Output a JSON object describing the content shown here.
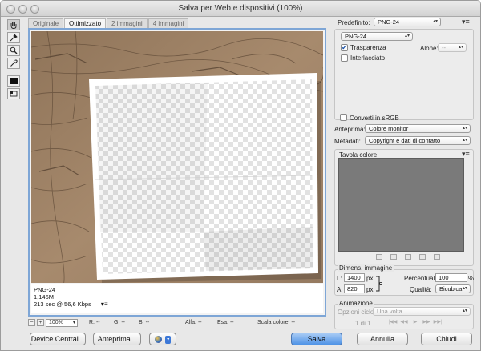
{
  "window": {
    "title": "Salva per Web e dispositivi (100%)"
  },
  "tabs": [
    "Originale",
    "Ottimizzato",
    "2 immagini",
    "4 immagini"
  ],
  "tools": [
    "hand-icon",
    "slice-select-icon",
    "zoom-icon",
    "eyedropper-icon",
    "color-swatch",
    "toggle-slices-icon"
  ],
  "preview_info": {
    "format": "PNG-24",
    "size": "1,146M",
    "time": "213 sec @ 56,6 Kbps",
    "menu": "▾≡"
  },
  "bottom_bar": {
    "zoom_minus": "−",
    "zoom_plus": "+",
    "zoom": "100%",
    "r_label": "R:",
    "r_value": "--",
    "g_label": "G:",
    "g_value": "--",
    "b_label": "B:",
    "b_value": "--",
    "alpha_label": "Alfa:",
    "alpha_value": "--",
    "esa_label": "Esa:",
    "esa_value": "--",
    "scale_label": "Scala colore:",
    "scale_value": "--"
  },
  "footer": {
    "device_central": "Device Central...",
    "preview": "Anteprima...",
    "save": "Salva",
    "cancel": "Annulla",
    "done": "Chiudi"
  },
  "settings": {
    "preset_label": "Predefinito:",
    "preset_value": "PNG-24",
    "panel_menu": "▾≡",
    "format_value": "PNG-24",
    "transparency_label": "Trasparenza",
    "transparency_checked": true,
    "matte_label": "Alone:",
    "matte_value": "--",
    "interlaced_label": "Interlacciato",
    "interlaced_checked": false,
    "convert_srgb_label": "Converti in sRGB",
    "convert_srgb_checked": false,
    "preview_label": "Anteprima:",
    "preview_value": "Colore monitor",
    "metadata_label": "Metadati:",
    "metadata_value": "Copyright e dati di contatto"
  },
  "color_table": {
    "title": "Tavola colore",
    "menu": "▾≡",
    "color": "#7a7a7a"
  },
  "image_size": {
    "title": "Dimens. immagine",
    "w_label": "L:",
    "w_value": "1400",
    "w_unit": "px",
    "h_label": "A:",
    "h_value": "820",
    "h_unit": "px",
    "percent_label": "Percentuale:",
    "percent_value": "100",
    "percent_unit": "%",
    "quality_label": "Qualità:",
    "quality_value": "Bicubica"
  },
  "animation": {
    "title": "Animazione",
    "loop_label": "Opzioni ciclo:",
    "loop_value": "Una volta",
    "frame_counter": "1 di 1"
  }
}
